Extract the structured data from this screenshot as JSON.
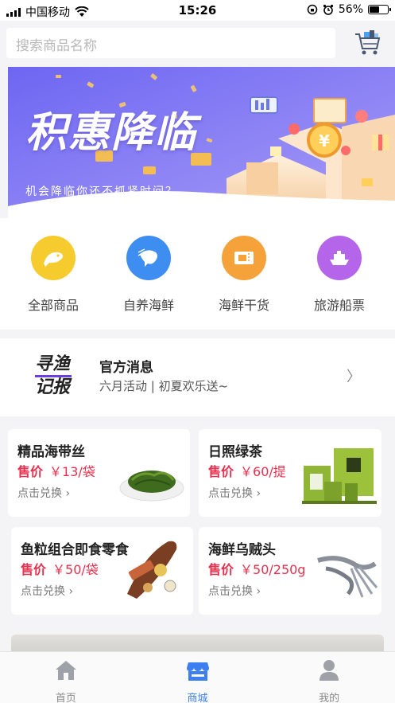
{
  "status_bar": {
    "carrier": "中国移动",
    "time": "15:26",
    "battery": "56%",
    "battery_level": 0.56
  },
  "search": {
    "placeholder": "搜索商品名称"
  },
  "banner": {
    "title": "积惠降临",
    "subtitle": "机会降临你还不抓紧时间？"
  },
  "categories": [
    {
      "label": "全部商品",
      "icon": "fish-icon",
      "color": "#f5cb2e"
    },
    {
      "label": "自养海鲜",
      "icon": "shrimp-icon",
      "color": "#3d8ef0"
    },
    {
      "label": "海鲜干货",
      "icon": "ticket-icon",
      "color": "#f6a23a"
    },
    {
      "label": "旅游船票",
      "icon": "ship-icon",
      "color": "#b565ea"
    }
  ],
  "news": {
    "logo_text_top": "寻渔",
    "logo_text_bottom": "记报",
    "title": "官方消息",
    "text": "六月活动 | 初夏欢乐送~",
    "arrow": "〉"
  },
  "products": [
    {
      "name": "精品海带丝",
      "price_label": "售价",
      "price": "￥13/袋",
      "action": "点击兑换",
      "image": "seaweed-dish"
    },
    {
      "name": "日照绿茶",
      "price_label": "售价",
      "price": "￥60/提",
      "action": "点击兑换",
      "image": "green-tea-box"
    },
    {
      "name": "鱼粒组合即食零食",
      "price_label": "售价",
      "price": "￥50/袋",
      "action": "点击兑换",
      "image": "fish-snack"
    },
    {
      "name": "海鲜乌贼头",
      "price_label": "售价",
      "price": "￥50/250g",
      "action": "点击兑换",
      "image": "dried-squid"
    }
  ],
  "tabbar": [
    {
      "label": "首页",
      "icon": "home-icon",
      "active": false
    },
    {
      "label": "商城",
      "icon": "store-icon",
      "active": true
    },
    {
      "label": "我的",
      "icon": "profile-icon",
      "active": false
    }
  ],
  "colors": {
    "accent": "#3d7ff0",
    "price": "#e8304e",
    "banner_gradient": [
      "#6e66f2",
      "#8f84f6"
    ]
  }
}
